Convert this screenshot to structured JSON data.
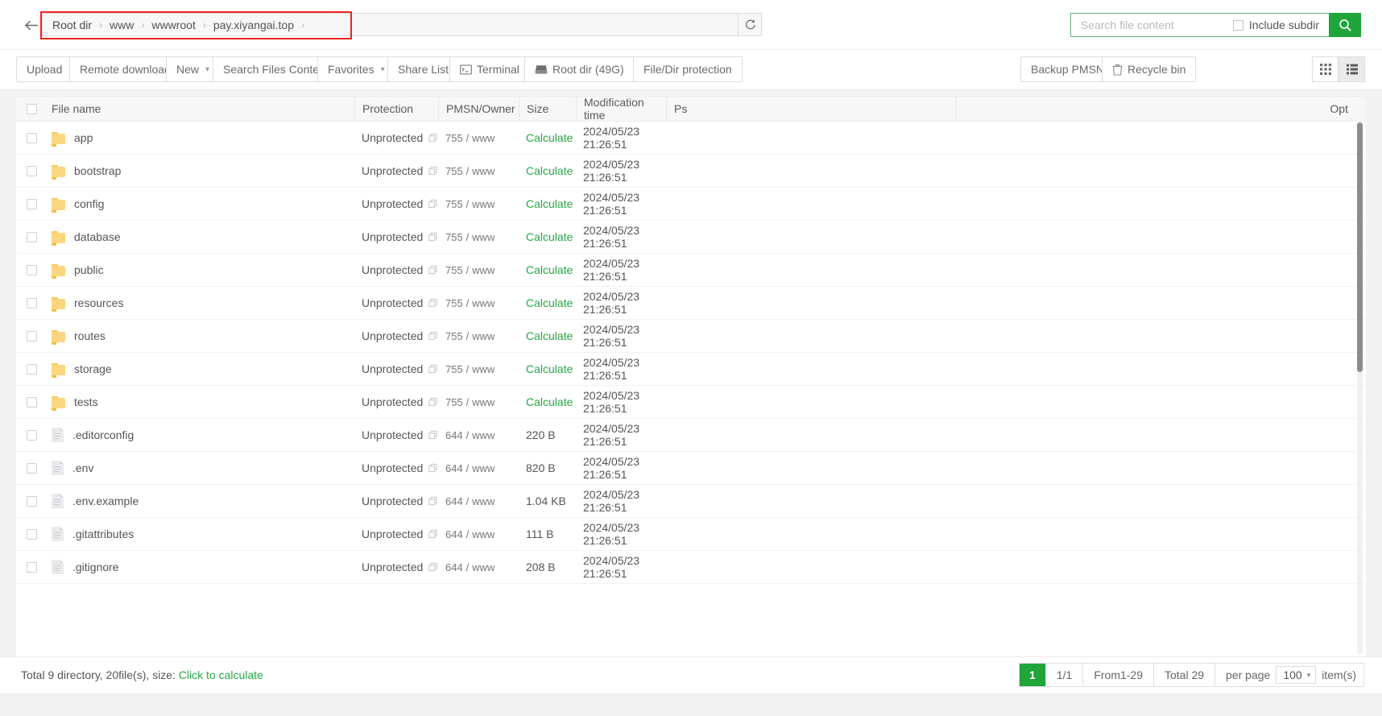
{
  "pathbar": {
    "back_label": "←",
    "breadcrumbs": [
      "Root dir",
      "www",
      "wwwroot",
      "pay.xiyangai.top"
    ],
    "separator": "›",
    "refresh_icon": "refresh-icon"
  },
  "search": {
    "value": "",
    "placeholder": "Search file content",
    "include_subdir_label": "Include subdir",
    "include_subdir_checked": false,
    "button_icon": "search-icon",
    "accent_color": "#20a53a",
    "border_color": "#64b578"
  },
  "toolbar": {
    "upload_label": "Upload",
    "remote_download_label": "Remote download",
    "new_label": "New",
    "search_files_content_label": "Search Files Content",
    "favorites_label": "Favorites",
    "share_list_label": "Share List",
    "terminal_label": "Terminal",
    "root_dir_label": "Root dir (49G)",
    "file_dir_protection_label": "File/Dir protection",
    "backup_pmsn_label": "Backup PMSN",
    "recycle_bin_label": "Recycle bin",
    "grid_view_icon": "grid-view-icon",
    "list_view_icon": "list-view-icon",
    "caret": "▾"
  },
  "table": {
    "headers": {
      "file_name": "File name",
      "protection": "Protection",
      "pmsn_owner": "PMSN/Owner",
      "size": "Size",
      "modification_time": "Modification time",
      "ps": "Ps",
      "opt": "Opt"
    },
    "calculate_label": "Calculate",
    "unprotected_label": "Unprotected",
    "rows": [
      {
        "type": "folder",
        "name": "app",
        "protection": "Unprotected",
        "pmsn": "755",
        "owner": "www",
        "size": "Calculate",
        "size_is_link": true,
        "time": "2024/05/23 21:26:51",
        "ps": ""
      },
      {
        "type": "folder",
        "name": "bootstrap",
        "protection": "Unprotected",
        "pmsn": "755",
        "owner": "www",
        "size": "Calculate",
        "size_is_link": true,
        "time": "2024/05/23 21:26:51",
        "ps": ""
      },
      {
        "type": "folder",
        "name": "config",
        "protection": "Unprotected",
        "pmsn": "755",
        "owner": "www",
        "size": "Calculate",
        "size_is_link": true,
        "time": "2024/05/23 21:26:51",
        "ps": ""
      },
      {
        "type": "folder",
        "name": "database",
        "protection": "Unprotected",
        "pmsn": "755",
        "owner": "www",
        "size": "Calculate",
        "size_is_link": true,
        "time": "2024/05/23 21:26:51",
        "ps": ""
      },
      {
        "type": "folder",
        "name": "public",
        "protection": "Unprotected",
        "pmsn": "755",
        "owner": "www",
        "size": "Calculate",
        "size_is_link": true,
        "time": "2024/05/23 21:26:51",
        "ps": ""
      },
      {
        "type": "folder",
        "name": "resources",
        "protection": "Unprotected",
        "pmsn": "755",
        "owner": "www",
        "size": "Calculate",
        "size_is_link": true,
        "time": "2024/05/23 21:26:51",
        "ps": ""
      },
      {
        "type": "folder",
        "name": "routes",
        "protection": "Unprotected",
        "pmsn": "755",
        "owner": "www",
        "size": "Calculate",
        "size_is_link": true,
        "time": "2024/05/23 21:26:51",
        "ps": ""
      },
      {
        "type": "folder",
        "name": "storage",
        "protection": "Unprotected",
        "pmsn": "755",
        "owner": "www",
        "size": "Calculate",
        "size_is_link": true,
        "time": "2024/05/23 21:26:51",
        "ps": ""
      },
      {
        "type": "folder",
        "name": "tests",
        "protection": "Unprotected",
        "pmsn": "755",
        "owner": "www",
        "size": "Calculate",
        "size_is_link": true,
        "time": "2024/05/23 21:26:51",
        "ps": ""
      },
      {
        "type": "file",
        "name": ".editorconfig",
        "protection": "Unprotected",
        "pmsn": "644",
        "owner": "www",
        "size": "220 B",
        "size_is_link": false,
        "time": "2024/05/23 21:26:51",
        "ps": ""
      },
      {
        "type": "file",
        "name": ".env",
        "protection": "Unprotected",
        "pmsn": "644",
        "owner": "www",
        "size": "820 B",
        "size_is_link": false,
        "time": "2024/05/23 21:26:51",
        "ps": ""
      },
      {
        "type": "file",
        "name": ".env.example",
        "protection": "Unprotected",
        "pmsn": "644",
        "owner": "www",
        "size": "1.04 KB",
        "size_is_link": false,
        "time": "2024/05/23 21:26:51",
        "ps": ""
      },
      {
        "type": "file",
        "name": ".gitattributes",
        "protection": "Unprotected",
        "pmsn": "644",
        "owner": "www",
        "size": "111 B",
        "size_is_link": false,
        "time": "2024/05/23 21:26:51",
        "ps": ""
      },
      {
        "type": "file",
        "name": ".gitignore",
        "protection": "Unprotected",
        "pmsn": "644",
        "owner": "www",
        "size": "208 B",
        "size_is_link": false,
        "time": "2024/05/23 21:26:51",
        "ps": ""
      }
    ]
  },
  "footer": {
    "total_text_prefix": "Total 9 directory, 20file(s), size:",
    "calculate_link": "Click to calculate",
    "pagination": {
      "current_page": "1",
      "page_of": "1/1",
      "range": "From1-29",
      "total": "Total 29",
      "per_page_label": "per page",
      "per_page_value": "100",
      "items_label": "item(s)"
    }
  }
}
